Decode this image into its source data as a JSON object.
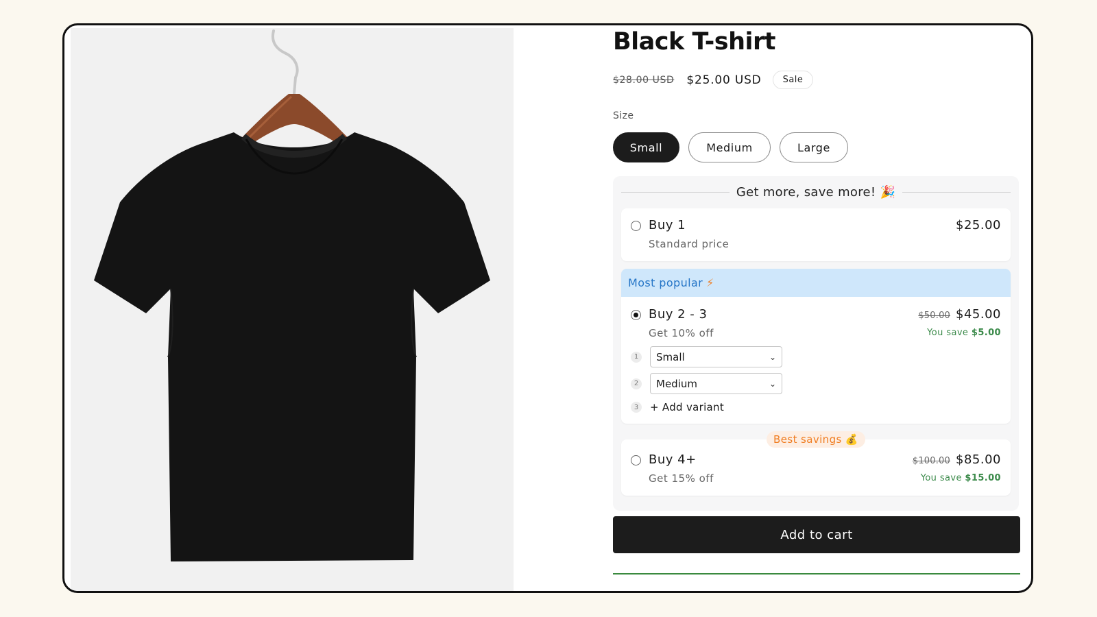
{
  "product": {
    "title": "Black T-shirt",
    "compare_price": "$28.00 USD",
    "price": "$25.00 USD",
    "badge": "Sale",
    "image_icon": "t-shirt-on-hanger"
  },
  "size": {
    "label": "Size",
    "options": [
      "Small",
      "Medium",
      "Large"
    ],
    "selected": "Small"
  },
  "bundle": {
    "heading": "Get more, save more!",
    "heading_icon": "🎉",
    "options": [
      {
        "title": "Buy 1",
        "subtitle": "Standard price",
        "price": "$25.00",
        "selected": false
      },
      {
        "ribbon": "Most popular",
        "ribbon_icon": "⚡",
        "title": "Buy 2 - 3",
        "subtitle": "Get 10% off",
        "compare_price": "$50.00",
        "price": "$45.00",
        "save_label": "You save",
        "save_amount": "$5.00",
        "selected": true,
        "variants": [
          {
            "num": "1",
            "value": "Small"
          },
          {
            "num": "2",
            "value": "Medium"
          }
        ],
        "add_variant": {
          "num": "3",
          "label": "+ Add variant"
        }
      },
      {
        "badge": "Best savings",
        "badge_icon": "💰",
        "title": "Buy 4+",
        "subtitle": "Get 15% off",
        "compare_price": "$100.00",
        "price": "$85.00",
        "save_label": "You save",
        "save_amount": "$15.00",
        "selected": false
      }
    ]
  },
  "cart": {
    "label": "Add to cart"
  },
  "colors": {
    "background": "#fbf8ef",
    "button_dark": "#1c1c1c",
    "popular_bg": "#cfe7fb",
    "popular_text": "#2676c7",
    "accent_orange": "#f07d21",
    "save_green": "#3b8a4a"
  }
}
